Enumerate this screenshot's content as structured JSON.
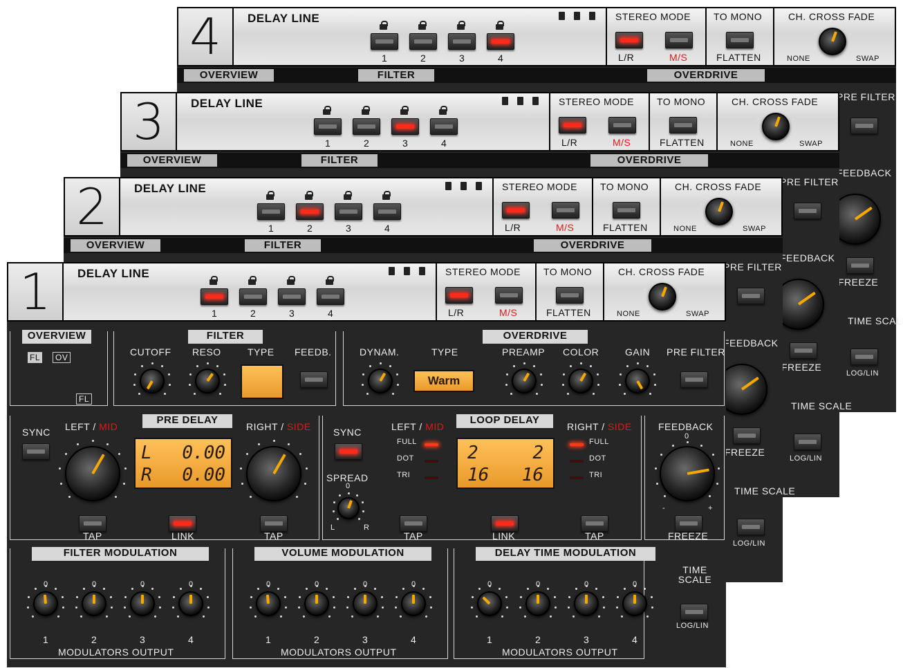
{
  "layers": [
    {
      "number": "4",
      "title": "DELAY LINE",
      "active_line": 4,
      "stereo_active": "L/R"
    },
    {
      "number": "3",
      "title": "DELAY LINE",
      "active_line": 3,
      "stereo_active": "L/R"
    },
    {
      "number": "2",
      "title": "DELAY LINE",
      "active_line": 2,
      "stereo_active": "L/R"
    },
    {
      "number": "1",
      "title": "DELAY LINE",
      "active_line": 1,
      "stereo_active": "L/R"
    }
  ],
  "header": {
    "lines": [
      "1",
      "2",
      "3",
      "4"
    ],
    "stereo_mode": "STEREO MODE",
    "lr": "L/R",
    "ms": "M/S",
    "to_mono": "TO MONO",
    "flatten": "FLATTEN",
    "cross_fade": "CH. CROSS FADE",
    "none": "NONE",
    "swap": "SWAP"
  },
  "tabs": {
    "overview": "OVERVIEW",
    "filter": "FILTER",
    "overdrive": "OVERDRIVE"
  },
  "overview": {
    "fl": "FL",
    "ov": "OV"
  },
  "filter": {
    "cutoff": "CUTOFF",
    "reso": "RESO",
    "type": "TYPE",
    "feedb": "FEEDB."
  },
  "overdrive": {
    "dynam": "DYNAM.",
    "type": "TYPE",
    "type_value": "Warm",
    "preamp": "PREAMP",
    "color": "COLOR",
    "gain": "GAIN",
    "pre_filter": "PRE FILTER"
  },
  "pre_delay": {
    "title": "PRE DELAY",
    "sync": "SYNC",
    "left": "LEFT / ",
    "mid": "MID",
    "right": "RIGHT / ",
    "side": "SIDE",
    "l_label": "L",
    "r_label": "R",
    "l_value": "0.00",
    "r_value": "0.00",
    "tap": "TAP",
    "link": "LINK"
  },
  "loop_delay": {
    "title": "LOOP DELAY",
    "sync": "SYNC",
    "spread": "SPREAD",
    "left": "LEFT / ",
    "mid": "MID",
    "right": "RIGHT / ",
    "side": "SIDE",
    "full": "FULL",
    "dot": "DOT",
    "tri": "TRI",
    "lcd_tl": "2",
    "lcd_tr": "2",
    "lcd_bl": "16",
    "lcd_br": "16",
    "tap": "TAP",
    "link": "LINK",
    "l": "L",
    "r": "R",
    "zero": "0"
  },
  "feedback": {
    "title": "FEEDBACK",
    "zero": "0",
    "freeze": "FREEZE",
    "minus": "-",
    "plus": "+"
  },
  "modulation": {
    "filter": "FILTER MODULATION",
    "volume": "VOLUME MODULATION",
    "delay_time": "DELAY TIME MODULATION",
    "outputs": "MODULATORS OUTPUT",
    "nums": [
      "1",
      "2",
      "3",
      "4"
    ],
    "zero": "0"
  },
  "time_scale": {
    "title": "TIME SCALE",
    "loglin": "LOG/LIN"
  },
  "colors": {
    "accent": "#f5a800",
    "led": "#ff2a1a",
    "panel": "#262626",
    "metal": "#dcdcdc",
    "lcd": "#f2ab40",
    "ms": "#e01818"
  }
}
